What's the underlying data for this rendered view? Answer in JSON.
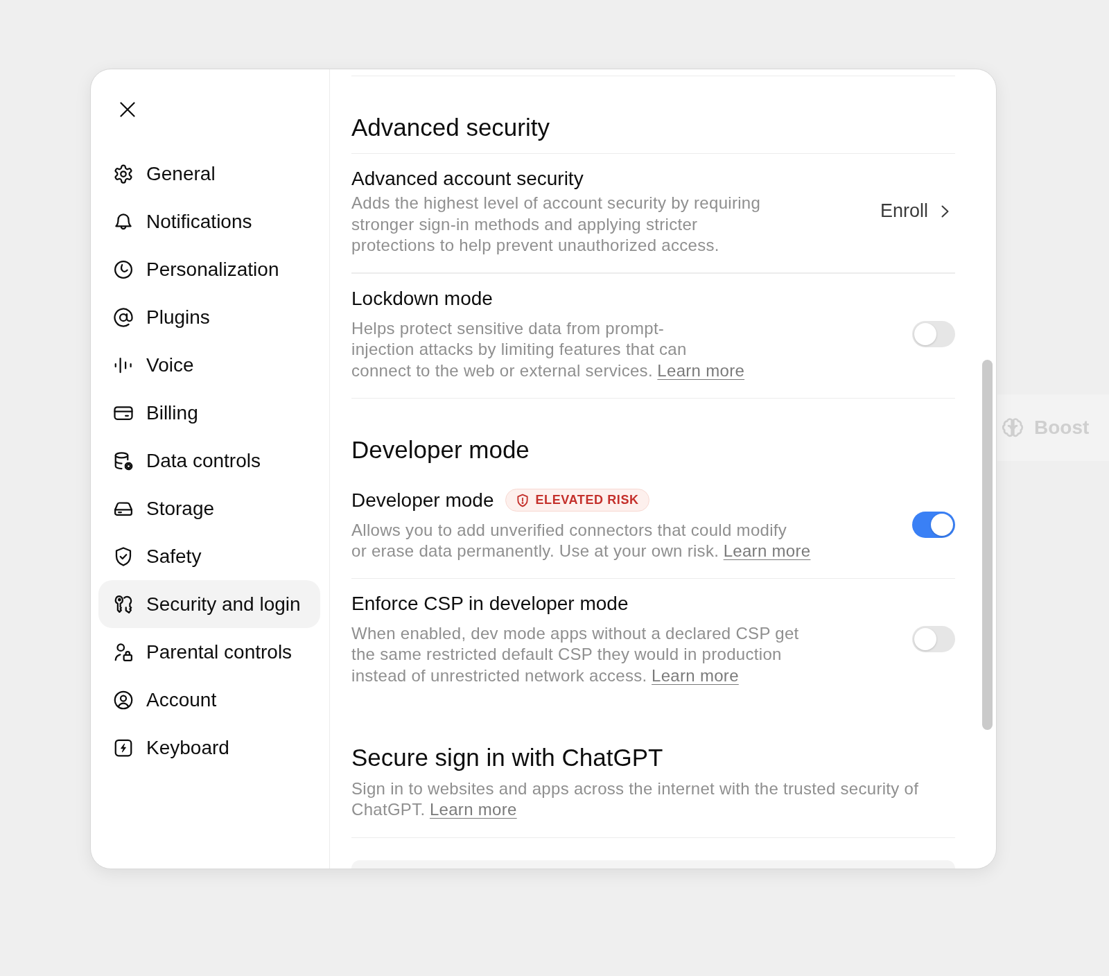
{
  "sidebar": {
    "items": [
      {
        "label": "General",
        "selected": false
      },
      {
        "label": "Notifications",
        "selected": false
      },
      {
        "label": "Personalization",
        "selected": false
      },
      {
        "label": "Plugins",
        "selected": false
      },
      {
        "label": "Voice",
        "selected": false
      },
      {
        "label": "Billing",
        "selected": false
      },
      {
        "label": "Data controls",
        "selected": false
      },
      {
        "label": "Storage",
        "selected": false
      },
      {
        "label": "Safety",
        "selected": false
      },
      {
        "label": "Security and login",
        "selected": true
      },
      {
        "label": "Parental controls",
        "selected": false
      },
      {
        "label": "Account",
        "selected": false
      },
      {
        "label": "Keyboard",
        "selected": false
      }
    ]
  },
  "content": {
    "sections": [
      {
        "title": "Advanced security",
        "rows": [
          {
            "kind": "action",
            "title": "Advanced account security",
            "description_lines": [
              "Adds the highest level of account security by requiring",
              "stronger sign-in methods and applying stricter",
              "protections to help prevent unauthorized access."
            ],
            "action": "Enroll"
          },
          {
            "kind": "toggle",
            "title": "Lockdown mode",
            "description_lines": [
              "Helps protect sensitive data from prompt-",
              "injection attacks by limiting features that can",
              "connect to the web or external services."
            ],
            "link": "Learn more",
            "on": false
          }
        ]
      },
      {
        "title": "Developer mode",
        "rows": [
          {
            "kind": "toggle",
            "title": "Developer mode",
            "badge": "ELEVATED RISK",
            "description_lines": [
              "Allows you to add unverified connectors that could modify",
              "or erase data permanently. Use at your own risk."
            ],
            "link": "Learn more",
            "on": true
          },
          {
            "kind": "toggle",
            "title": "Enforce CSP in developer mode",
            "description_lines": [
              "When enabled, dev mode apps without a declared CSP get",
              "the same restricted default CSP they would in production",
              "instead of unrestricted network access."
            ],
            "link": "Learn more",
            "on": false
          }
        ]
      },
      {
        "title": "Secure sign in with ChatGPT",
        "description_lines": [
          "Sign in to websites and apps across the internet with the trusted security of",
          "ChatGPT."
        ],
        "link": "Learn more"
      }
    ]
  },
  "background_panel": {
    "label": "Boost"
  }
}
